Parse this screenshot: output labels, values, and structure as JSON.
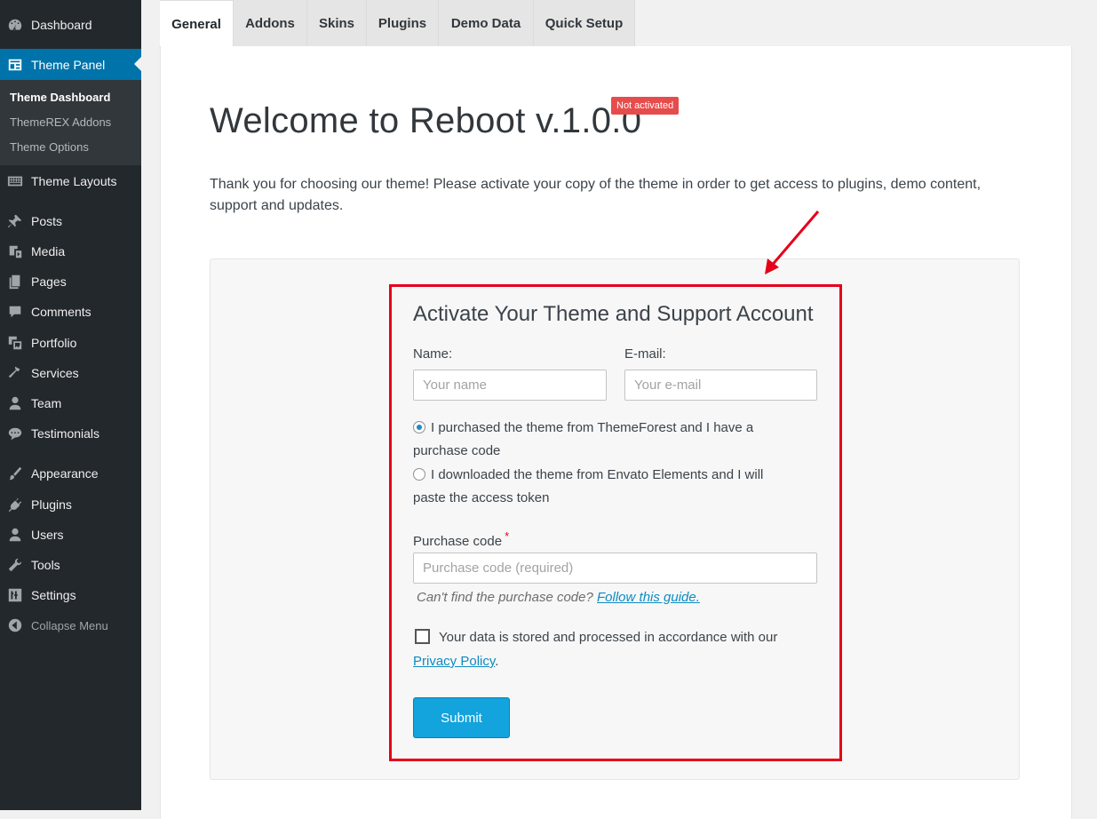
{
  "sidebar": {
    "items": [
      {
        "label": "Dashboard",
        "icon": "dashboard-icon"
      },
      {
        "label": "Theme Panel",
        "icon": "theme-panel-icon"
      },
      {
        "label": "Theme Layouts",
        "icon": "layouts-icon"
      },
      {
        "label": "Posts",
        "icon": "pushpin-icon"
      },
      {
        "label": "Media",
        "icon": "media-icon"
      },
      {
        "label": "Pages",
        "icon": "pages-icon"
      },
      {
        "label": "Comments",
        "icon": "comment-icon"
      },
      {
        "label": "Portfolio",
        "icon": "portfolio-icon"
      },
      {
        "label": "Services",
        "icon": "hammer-icon"
      },
      {
        "label": "Team",
        "icon": "person-icon"
      },
      {
        "label": "Testimonials",
        "icon": "speech-bubbles-icon"
      },
      {
        "label": "Appearance",
        "icon": "paintbrush-icon"
      },
      {
        "label": "Plugins",
        "icon": "plug-icon"
      },
      {
        "label": "Users",
        "icon": "users-icon"
      },
      {
        "label": "Tools",
        "icon": "wrench-icon"
      },
      {
        "label": "Settings",
        "icon": "sliders-icon"
      }
    ],
    "submenu": [
      "Theme Dashboard",
      "ThemeREX Addons",
      "Theme Options"
    ],
    "collapse_label": "Collapse Menu"
  },
  "tabs": [
    "General",
    "Addons",
    "Skins",
    "Plugins",
    "Demo Data",
    "Quick Setup"
  ],
  "main": {
    "title": "Welcome to Reboot v.1.0.0",
    "status_badge": "Not activated",
    "intro": "Thank you for choosing our theme! Please activate your copy of the theme in order to get access to plugins, demo content, support and updates."
  },
  "form": {
    "title": "Activate Your Theme and Support Account",
    "name_label": "Name:",
    "name_placeholder": "Your name",
    "email_label": "E-mail:",
    "email_placeholder": "Your e-mail",
    "radio_purchased": "I purchased the theme from ThemeForest and I have a purchase code",
    "radio_downloaded": "I downloaded the theme from Envato Elements and I will paste the access token",
    "purchase_label": "Purchase code",
    "required_mark": "*",
    "purchase_placeholder": "Purchase code (required)",
    "hint": "Can't find the purchase code?",
    "hint_link": "Follow this guide.",
    "consent": "Your data is stored and processed in accordance with our",
    "privacy_link": "Privacy Policy",
    "consent_end": ".",
    "submit": "Submit"
  },
  "colors": {
    "sidebar_bg": "#23282d",
    "active_menu": "#0073aa",
    "badge": "#e64c4c",
    "highlight": "#e5001a",
    "submit_button": "#13a3dd",
    "link": "#0e8bc2"
  }
}
